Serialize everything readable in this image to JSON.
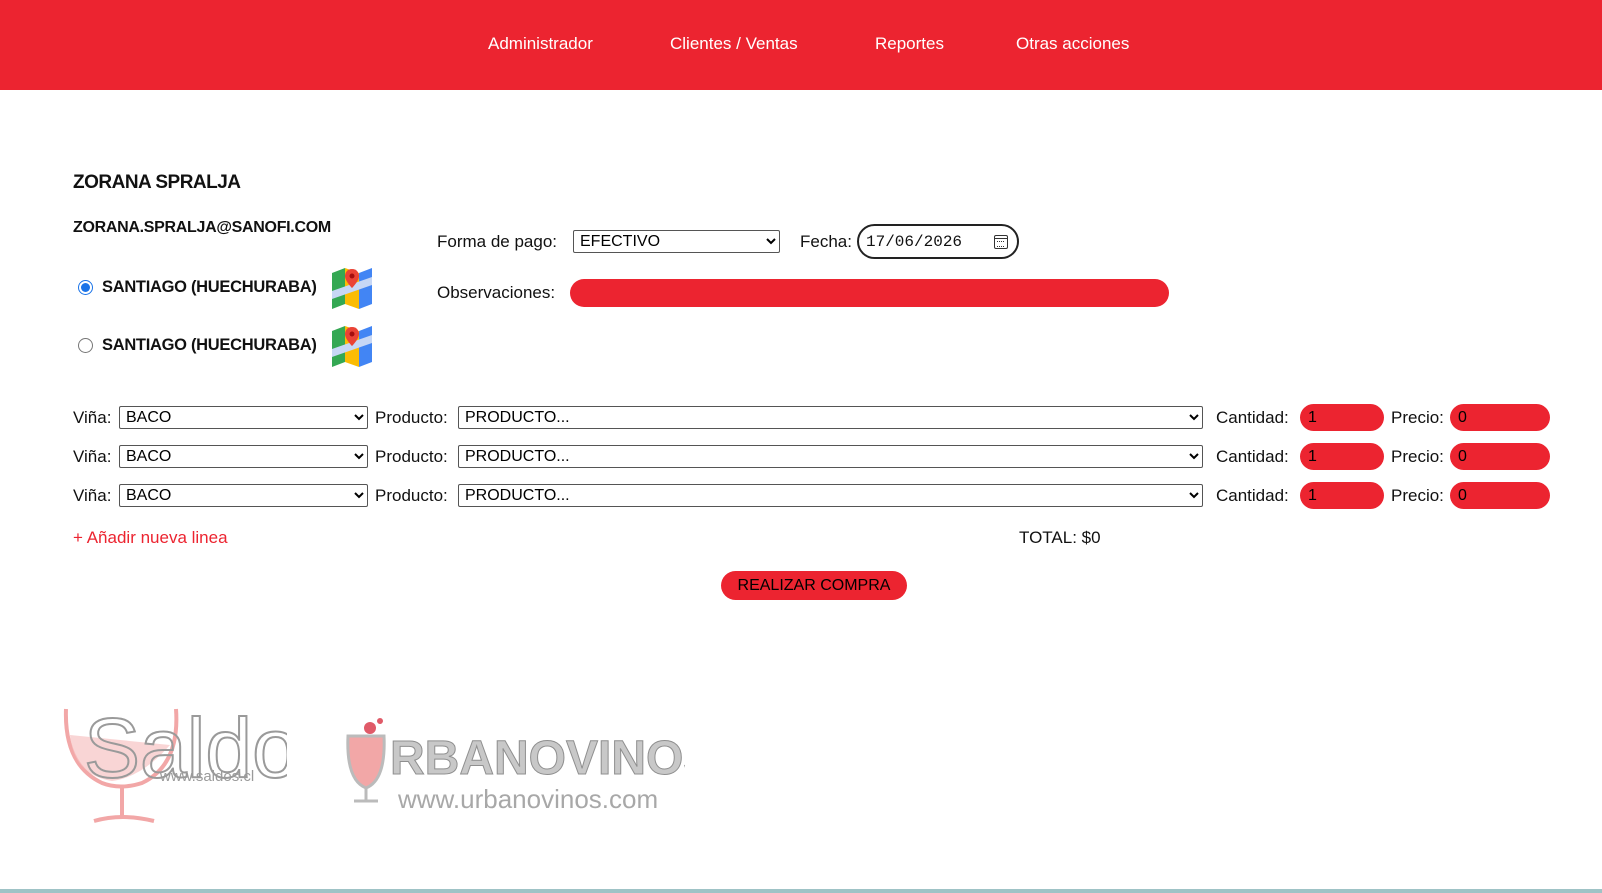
{
  "nav": {
    "items": [
      "Administrador",
      "Clientes / Ventas",
      "Reportes",
      "Otras acciones"
    ]
  },
  "customer": {
    "name": "ZORANA SPRALJA",
    "email": "ZORANA.SPRALJA@SANOFI.COM",
    "addresses": [
      {
        "label": "SANTIAGO (HUECHURABA)",
        "selected": true,
        "icon": "map-icon"
      },
      {
        "label": "SANTIAGO (HUECHURABA)",
        "selected": false,
        "icon": "map-icon"
      }
    ]
  },
  "order": {
    "payment_label": "Forma de pago:",
    "payment_value": "EFECTIVO",
    "date_label": "Fecha:",
    "date_value": "17/06/2026",
    "notes_label": "Observaciones:",
    "notes_value": ""
  },
  "lines": {
    "vina_label": "Viña:",
    "product_label": "Producto:",
    "qty_label": "Cantidad:",
    "price_label": "Precio:",
    "rows": [
      {
        "vina": "BACO",
        "product": "PRODUCTO...",
        "qty": "1",
        "price": "0"
      },
      {
        "vina": "BACO",
        "product": "PRODUCTO...",
        "qty": "1",
        "price": "0"
      },
      {
        "vina": "BACO",
        "product": "PRODUCTO...",
        "qty": "1",
        "price": "0"
      }
    ]
  },
  "add_line_label": "+ Añadir nueva linea",
  "total_label": "TOTAL: $0",
  "submit_label": "REALIZAR COMPRA",
  "logos": {
    "saldos": {
      "name": "Saldos",
      "url": "www.saldos.cl"
    },
    "urbanovinos": {
      "name": "RBANOVINOS",
      "url": "www.urbanovinos.com"
    }
  },
  "colors": {
    "brand_red": "#ec2430",
    "footer_line": "#9fc3c6"
  }
}
